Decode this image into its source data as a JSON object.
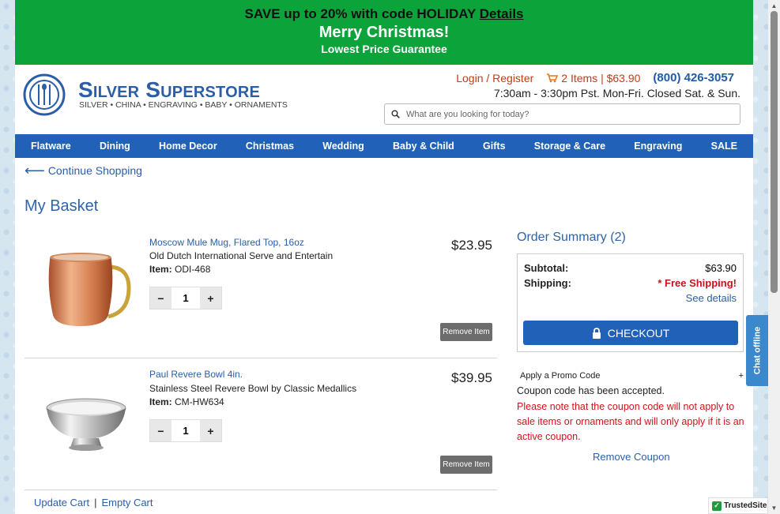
{
  "promo": {
    "line1": "SAVE up to 20% with code HOLIDAY",
    "details_link": "Details",
    "line2": "Merry Christmas!",
    "line3": "Lowest Price Guarantee"
  },
  "header": {
    "logo_title": "Silver Superstore",
    "logo_sub": "SILVER • CHINA • ENGRAVING • BABY • ORNAMENTS",
    "login": "Login / Register",
    "cart_summary": "2 Items | $63.90",
    "phone": "(800) 426-3057",
    "hours": "7:30am - 3:30pm Pst. Mon-Fri. Closed Sat. & Sun.",
    "search_placeholder": "What are you looking for today?"
  },
  "nav": {
    "items": [
      "Flatware",
      "Dining",
      "Home Decor",
      "Christmas",
      "Wedding",
      "Baby & Child",
      "Gifts",
      "Storage & Care",
      "Engraving",
      "SALE"
    ]
  },
  "page": {
    "continue_label": "Continue Shopping",
    "title": "My Basket"
  },
  "cart": {
    "items": [
      {
        "name": "Moscow Mule Mug, Flared Top, 16oz",
        "description": "Old Dutch International Serve and Entertain",
        "item_label": "Item:",
        "item_code": "ODI-468",
        "price": "$23.95",
        "qty": "1",
        "remove_label": "Remove Item"
      },
      {
        "name": "Paul Revere Bowl 4in.",
        "description": "Stainless Steel Revere Bowl by Classic Medallics",
        "item_label": "Item:",
        "item_code": "CM-HW634",
        "price": "$39.95",
        "qty": "1",
        "remove_label": "Remove Item"
      }
    ],
    "update_label": "Update Cart",
    "separator": "|",
    "empty_label": "Empty Cart"
  },
  "summary": {
    "title": "Order Summary (2)",
    "subtotal_label": "Subtotal:",
    "subtotal_value": "$63.90",
    "shipping_label": "Shipping:",
    "shipping_value": "* Free Shipping!",
    "see_details": "See details",
    "checkout_label": "CHECKOUT",
    "promo_label": "Apply a Promo Code",
    "promo_toggle": "+",
    "coupon_accepted": "Coupon code has been accepted.",
    "coupon_note": "Please note that the coupon code will not apply to sale items or ornaments and will only apply if it is an active coupon.",
    "remove_coupon": "Remove Coupon"
  },
  "widgets": {
    "chat_label": "Chat offline",
    "trusted_label": "TrustedSite"
  },
  "colors": {
    "promo_green": "#0ba33a",
    "brand_blue": "#2162b8",
    "link_red": "#c33a14",
    "alert_red": "#d1121b"
  }
}
